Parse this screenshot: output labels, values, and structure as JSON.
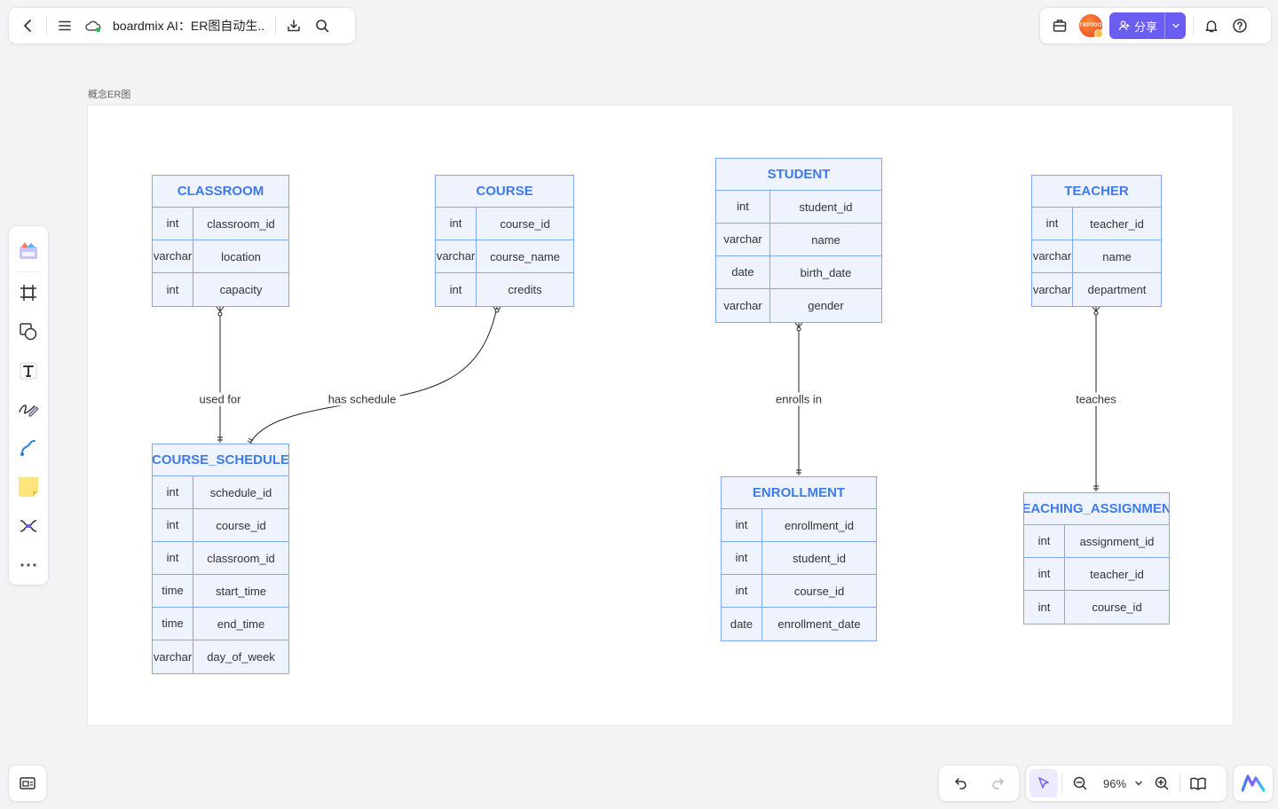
{
  "header": {
    "doc_title": "boardmix AI：ER图自动生..",
    "avatar_text": "ГИРТОО",
    "share_label": "分享"
  },
  "canvas": {
    "frame_label": "概念ER图",
    "zoom": "96%"
  },
  "colors": {
    "accent": "#6b5cf2",
    "table_border": "#7da8f5",
    "table_fill": "#eef3fe",
    "table_title": "#3f7be8"
  },
  "tables": {
    "classroom": {
      "title": "CLASSROOM",
      "rows": [
        {
          "type": "int",
          "name": "classroom_id"
        },
        {
          "type": "varchar",
          "name": "location"
        },
        {
          "type": "int",
          "name": "capacity"
        }
      ]
    },
    "course": {
      "title": "COURSE",
      "rows": [
        {
          "type": "int",
          "name": "course_id"
        },
        {
          "type": "varchar",
          "name": "course_name"
        },
        {
          "type": "int",
          "name": "credits"
        }
      ]
    },
    "student": {
      "title": "STUDENT",
      "rows": [
        {
          "type": "int",
          "name": "student_id"
        },
        {
          "type": "varchar",
          "name": "name"
        },
        {
          "type": "date",
          "name": "birth_date"
        },
        {
          "type": "varchar",
          "name": "gender"
        }
      ]
    },
    "teacher": {
      "title": "TEACHER",
      "rows": [
        {
          "type": "int",
          "name": "teacher_id"
        },
        {
          "type": "varchar",
          "name": "name"
        },
        {
          "type": "varchar",
          "name": "department"
        }
      ]
    },
    "course_schedule": {
      "title": "COURSE_SCHEDULE",
      "rows": [
        {
          "type": "int",
          "name": "schedule_id"
        },
        {
          "type": "int",
          "name": "course_id"
        },
        {
          "type": "int",
          "name": "classroom_id"
        },
        {
          "type": "time",
          "name": "start_time"
        },
        {
          "type": "time",
          "name": "end_time"
        },
        {
          "type": "varchar",
          "name": "day_of_week"
        }
      ]
    },
    "enrollment": {
      "title": "ENROLLMENT",
      "rows": [
        {
          "type": "int",
          "name": "enrollment_id"
        },
        {
          "type": "int",
          "name": "student_id"
        },
        {
          "type": "int",
          "name": "course_id"
        },
        {
          "type": "date",
          "name": "enrollment_date"
        }
      ]
    },
    "teaching_assignment": {
      "title": "TEACHING_ASSIGNMENT",
      "rows": [
        {
          "type": "int",
          "name": "assignment_id"
        },
        {
          "type": "int",
          "name": "teacher_id"
        },
        {
          "type": "int",
          "name": "course_id"
        }
      ]
    }
  },
  "relations": {
    "used_for": "used for",
    "has_schedule": "has schedule",
    "enrolls_in": "enrolls in",
    "teaches": "teaches"
  }
}
